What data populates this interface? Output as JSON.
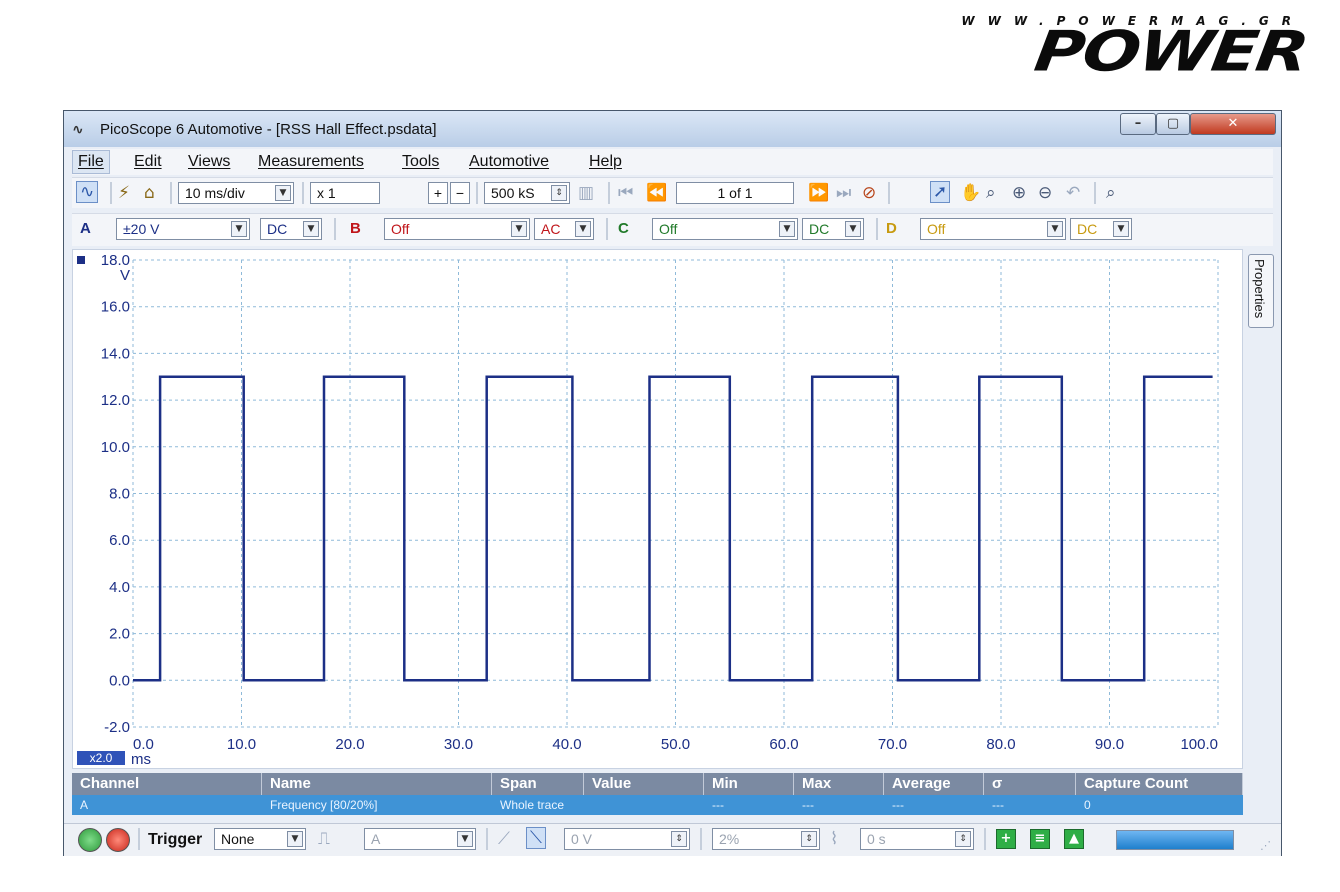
{
  "brand": {
    "url": "WWW.POWERMAG.GR",
    "logo": "POWER"
  },
  "window": {
    "title": "PicoScope 6 Automotive - [RSS Hall Effect.psdata]",
    "controls": {
      "minimize": "–",
      "maximize": "▢",
      "close": "✕"
    }
  },
  "menu": [
    "File",
    "Edit",
    "Views",
    "Measurements",
    "Tools",
    "Automotive",
    "Help"
  ],
  "toolbar1": {
    "timebase": "10 ms/div",
    "zoom": "x 1",
    "samples": "500 kS",
    "page": "1 of 1"
  },
  "toolbar2": {
    "channels": [
      {
        "label": "A",
        "range": "±20 V",
        "coupling": "DC",
        "color": "#1c2f86"
      },
      {
        "label": "B",
        "range": "Off",
        "coupling": "AC",
        "color": "#c0151a"
      },
      {
        "label": "C",
        "range": "Off",
        "coupling": "DC",
        "color": "#217a2a"
      },
      {
        "label": "D",
        "range": "Off",
        "coupling": "DC",
        "color": "#c79a10"
      }
    ]
  },
  "scope": {
    "properties_tab": "Properties",
    "x_scale_badge": "x2.0",
    "x_unit": "ms",
    "y_unit": "V"
  },
  "chart_data": {
    "type": "line",
    "title": "",
    "xlabel": "ms",
    "ylabel": "V",
    "xlim": [
      0,
      100
    ],
    "ylim": [
      -2,
      18
    ],
    "x_ticks": [
      "0.0",
      "10.0",
      "20.0",
      "30.0",
      "40.0",
      "50.0",
      "60.0",
      "70.0",
      "80.0",
      "90.0",
      "100.0"
    ],
    "y_ticks": [
      "-2.0",
      "0.0",
      "2.0",
      "4.0",
      "6.0",
      "8.0",
      "10.0",
      "12.0",
      "14.0",
      "16.0",
      "18.0"
    ],
    "grid": true,
    "series": [
      {
        "name": "A",
        "color": "#1c2f86",
        "x": [
          0,
          2.5,
          2.5,
          10.2,
          10.2,
          17.6,
          17.6,
          25,
          25,
          32.6,
          32.6,
          40.5,
          40.5,
          47.6,
          47.6,
          55,
          55,
          62.6,
          62.6,
          70.5,
          70.5,
          78,
          78,
          85.6,
          85.6,
          93.2,
          93.2,
          99.5
        ],
        "y": [
          0,
          0,
          13,
          13,
          0,
          0,
          13,
          13,
          0,
          0,
          13,
          13,
          0,
          0,
          13,
          13,
          0,
          0,
          13,
          13,
          0,
          0,
          13,
          13,
          0,
          0,
          13,
          13
        ]
      }
    ]
  },
  "measurements": {
    "headers": [
      "Channel",
      "Name",
      "Span",
      "Value",
      "Min",
      "Max",
      "Average",
      "σ",
      "Capture Count"
    ],
    "rows": [
      [
        "A",
        "Frequency [80/20%]",
        "Whole trace",
        "",
        "---",
        "---",
        "---",
        "---",
        "0"
      ]
    ]
  },
  "statusbar": {
    "trigger_label": "Trigger",
    "trigger_mode": "None",
    "trigger_channel": "A",
    "threshold": "0 V",
    "hysteresis": "2%",
    "delay": "0 s"
  }
}
